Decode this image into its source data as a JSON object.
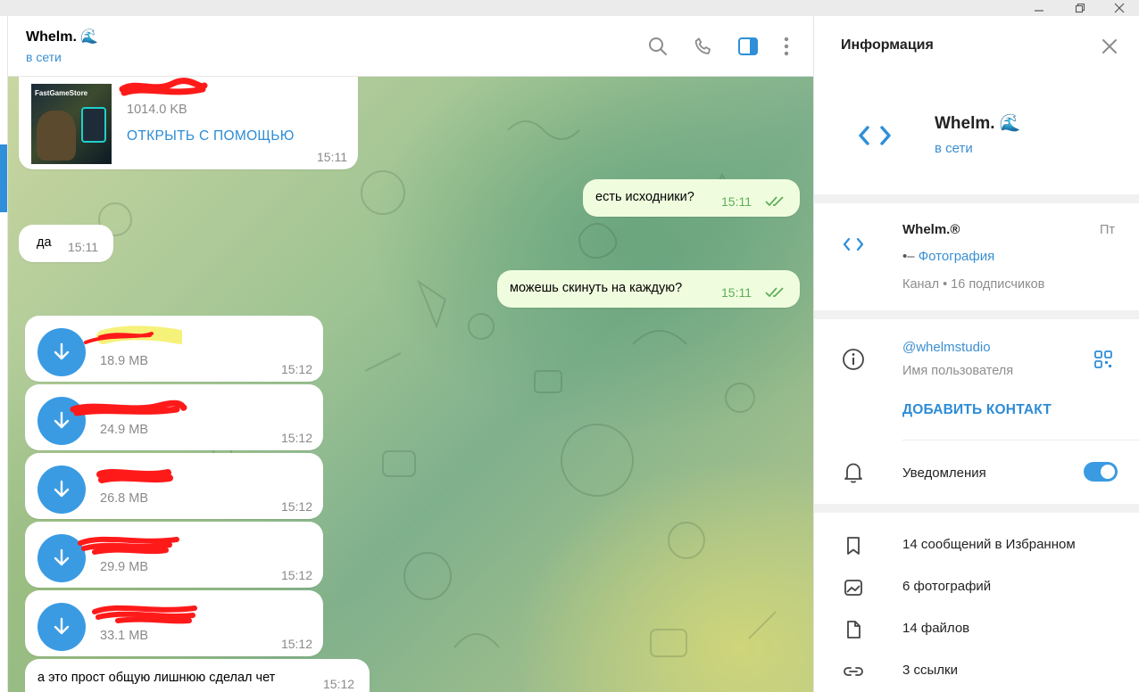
{
  "window": {
    "minimize_icon": "minimize-icon",
    "restore_icon": "restore-icon",
    "close_icon": "close-icon"
  },
  "chat": {
    "name": "Whelm. 🌊",
    "status": "в сети",
    "header_icons": [
      "search-icon",
      "phone-icon",
      "sidebar-toggle-icon",
      "more-vertical-icon"
    ],
    "messages": {
      "file_top": {
        "size": "1014.0 KB",
        "action": "ОТКРЫТЬ С ПОМОЩЬЮ",
        "time": "15:11"
      },
      "out1": {
        "text": "есть исходники?",
        "time": "15:11"
      },
      "in1": {
        "text": "да",
        "time": "15:11"
      },
      "out2": {
        "text": "можешь скинуть на каждую?",
        "time": "15:11"
      },
      "files": [
        {
          "size": "18.9 MB",
          "time": "15:12"
        },
        {
          "size": "24.9 MB",
          "time": "15:12"
        },
        {
          "size": "26.8 MB",
          "time": "15:12"
        },
        {
          "size": "29.9 MB",
          "time": "15:12"
        },
        {
          "size": "33.1 MB",
          "time": "15:12"
        }
      ],
      "last": {
        "text": "а это прост общую лишнюю сделал чет",
        "time": "15:12"
      }
    },
    "thumbnail_label": "FastGameStore"
  },
  "info": {
    "title": "Информация",
    "profile": {
      "name": "Whelm. 🌊",
      "status": "в сети"
    },
    "channel": {
      "name": "Whelm.®",
      "day": "Пт",
      "last_post_prefix": "•–",
      "last_post": "Фотография",
      "meta": "Канал • 16 подписчиков"
    },
    "username": {
      "value": "@whelmstudio",
      "label": "Имя пользователя"
    },
    "add_contact": "ДОБАВИТЬ КОНТАКТ",
    "notifications": {
      "label": "Уведомления",
      "enabled": true
    },
    "media": [
      {
        "label": "14 сообщений в Избранном",
        "icon": "bookmark-icon"
      },
      {
        "label": "6 фотографий",
        "icon": "photo-icon"
      },
      {
        "label": "14 файлов",
        "icon": "file-icon"
      },
      {
        "label": "3 ссылки",
        "icon": "link-icon"
      }
    ]
  },
  "colors": {
    "accent": "#3a9be3",
    "link": "#3a8fd2",
    "outgoing_bubble": "#effdde",
    "read_check": "#5fae5a",
    "redaction": "#ff1a1a",
    "highlight": "#f5f06a"
  }
}
